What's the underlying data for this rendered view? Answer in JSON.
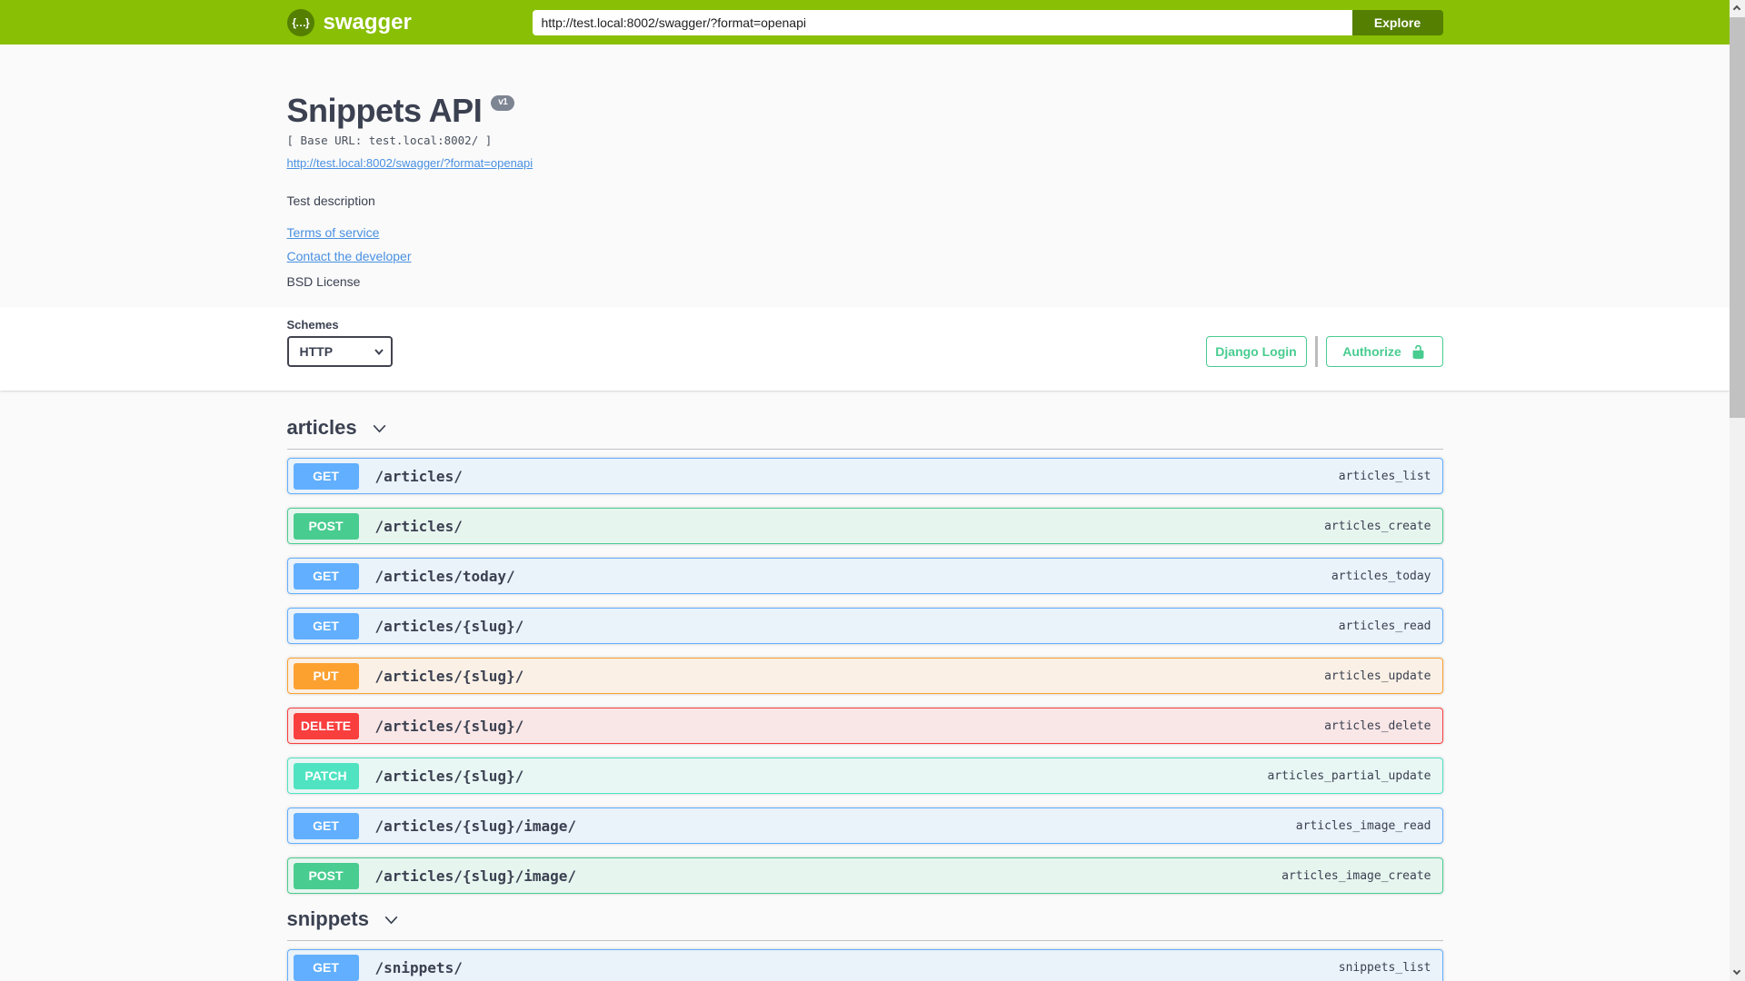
{
  "topbar": {
    "brand": "swagger",
    "logo_glyph": "{…}",
    "url_value": "http://test.local:8002/swagger/?format=openapi",
    "explore_label": "Explore"
  },
  "info": {
    "title": "Snippets API",
    "version_badge": "v1",
    "base_url_line": "[ Base URL: test.local:8002/ ]",
    "spec_link": "http://test.local:8002/swagger/?format=openapi",
    "description": "Test description",
    "terms_link": "Terms of service",
    "contact_link": "Contact the developer",
    "license_text": "BSD License"
  },
  "scheme_bar": {
    "schemes_label": "Schemes",
    "selected_scheme": "HTTP",
    "django_login_label": "Django Login",
    "authorize_label": "Authorize",
    "authorize_icon": "unlock-icon"
  },
  "colors": {
    "topbar_bg": "#89bf04",
    "explore_btn": "#547f00",
    "auth_green": "#49cc90",
    "text": "#3b4151",
    "link": "#4990e2",
    "badge_version_bg": "#7d8492"
  },
  "method_colors": {
    "GET": "#61affe",
    "POST": "#49cc90",
    "PUT": "#fca130",
    "DELETE": "#f93e3e",
    "PATCH": "#50e3c2"
  },
  "sections": [
    {
      "name": "articles",
      "operations": [
        {
          "method": "GET",
          "path": "/articles/",
          "op_id": "articles_list"
        },
        {
          "method": "POST",
          "path": "/articles/",
          "op_id": "articles_create"
        },
        {
          "method": "GET",
          "path": "/articles/today/",
          "op_id": "articles_today"
        },
        {
          "method": "GET",
          "path": "/articles/{slug}/",
          "op_id": "articles_read"
        },
        {
          "method": "PUT",
          "path": "/articles/{slug}/",
          "op_id": "articles_update"
        },
        {
          "method": "DELETE",
          "path": "/articles/{slug}/",
          "op_id": "articles_delete"
        },
        {
          "method": "PATCH",
          "path": "/articles/{slug}/",
          "op_id": "articles_partial_update"
        },
        {
          "method": "GET",
          "path": "/articles/{slug}/image/",
          "op_id": "articles_image_read"
        },
        {
          "method": "POST",
          "path": "/articles/{slug}/image/",
          "op_id": "articles_image_create"
        }
      ]
    },
    {
      "name": "snippets",
      "operations": [
        {
          "method": "GET",
          "path": "/snippets/",
          "op_id": "snippets_list"
        }
      ]
    }
  ]
}
